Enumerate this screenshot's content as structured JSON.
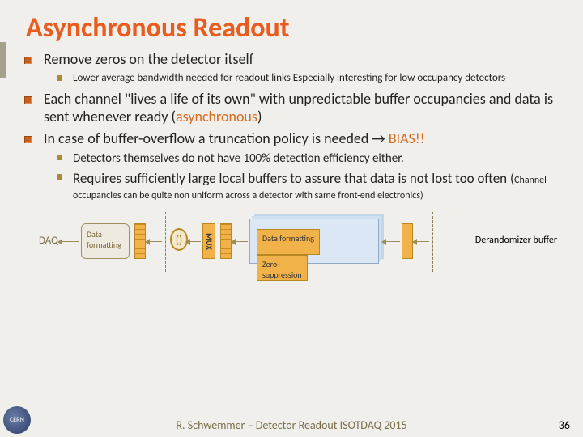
{
  "title": "Asynchronous Readout",
  "bullets": {
    "b1": "Remove zeros on the detector itself",
    "b1_sub": "Lower average bandwidth needed for readout links Especially interesting for low occupancy detectors",
    "b2_pre": "Each channel \"lives a life of its own\" with unpredictable buffer occupancies and data is sent whenever ready (",
    "b2_orange": "asynchronous",
    "b2_post": ")",
    "b3_pre": "In case of buffer-overflow a truncation policy is needed → ",
    "b3_orange": "BIAS!!",
    "b3_sub1": "Detectors themselves do not have 100% detection efficiency either.",
    "b4_main": "Requires sufficiently large local buffers to assure that data is not lost too often (",
    "b4_note": "Channel occupancies can be quite non uniform across a detector with same front-end electronics)"
  },
  "diagram": {
    "daq": "DAQ",
    "data_formatting": "Data formatting",
    "mux": "MUX",
    "zero_suppression": "Zero-\nsuppression",
    "derand": "Derandomizer buffer"
  },
  "footer": "R. Schwemmer – Detector Readout ISOTDAQ 2015",
  "page": "36",
  "logo": "CERN"
}
